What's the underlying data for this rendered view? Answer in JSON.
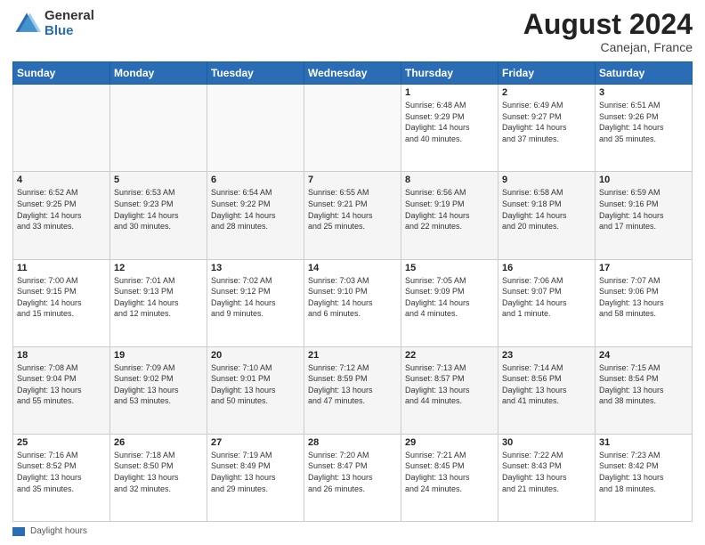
{
  "logo": {
    "general": "General",
    "blue": "Blue"
  },
  "title": {
    "month": "August 2024",
    "location": "Canejan, France"
  },
  "legend": {
    "label": "Daylight hours"
  },
  "headers": [
    "Sunday",
    "Monday",
    "Tuesday",
    "Wednesday",
    "Thursday",
    "Friday",
    "Saturday"
  ],
  "weeks": [
    [
      {
        "day": "",
        "info": ""
      },
      {
        "day": "",
        "info": ""
      },
      {
        "day": "",
        "info": ""
      },
      {
        "day": "",
        "info": ""
      },
      {
        "day": "1",
        "info": "Sunrise: 6:48 AM\nSunset: 9:29 PM\nDaylight: 14 hours\nand 40 minutes."
      },
      {
        "day": "2",
        "info": "Sunrise: 6:49 AM\nSunset: 9:27 PM\nDaylight: 14 hours\nand 37 minutes."
      },
      {
        "day": "3",
        "info": "Sunrise: 6:51 AM\nSunset: 9:26 PM\nDaylight: 14 hours\nand 35 minutes."
      }
    ],
    [
      {
        "day": "4",
        "info": "Sunrise: 6:52 AM\nSunset: 9:25 PM\nDaylight: 14 hours\nand 33 minutes."
      },
      {
        "day": "5",
        "info": "Sunrise: 6:53 AM\nSunset: 9:23 PM\nDaylight: 14 hours\nand 30 minutes."
      },
      {
        "day": "6",
        "info": "Sunrise: 6:54 AM\nSunset: 9:22 PM\nDaylight: 14 hours\nand 28 minutes."
      },
      {
        "day": "7",
        "info": "Sunrise: 6:55 AM\nSunset: 9:21 PM\nDaylight: 14 hours\nand 25 minutes."
      },
      {
        "day": "8",
        "info": "Sunrise: 6:56 AM\nSunset: 9:19 PM\nDaylight: 14 hours\nand 22 minutes."
      },
      {
        "day": "9",
        "info": "Sunrise: 6:58 AM\nSunset: 9:18 PM\nDaylight: 14 hours\nand 20 minutes."
      },
      {
        "day": "10",
        "info": "Sunrise: 6:59 AM\nSunset: 9:16 PM\nDaylight: 14 hours\nand 17 minutes."
      }
    ],
    [
      {
        "day": "11",
        "info": "Sunrise: 7:00 AM\nSunset: 9:15 PM\nDaylight: 14 hours\nand 15 minutes."
      },
      {
        "day": "12",
        "info": "Sunrise: 7:01 AM\nSunset: 9:13 PM\nDaylight: 14 hours\nand 12 minutes."
      },
      {
        "day": "13",
        "info": "Sunrise: 7:02 AM\nSunset: 9:12 PM\nDaylight: 14 hours\nand 9 minutes."
      },
      {
        "day": "14",
        "info": "Sunrise: 7:03 AM\nSunset: 9:10 PM\nDaylight: 14 hours\nand 6 minutes."
      },
      {
        "day": "15",
        "info": "Sunrise: 7:05 AM\nSunset: 9:09 PM\nDaylight: 14 hours\nand 4 minutes."
      },
      {
        "day": "16",
        "info": "Sunrise: 7:06 AM\nSunset: 9:07 PM\nDaylight: 14 hours\nand 1 minute."
      },
      {
        "day": "17",
        "info": "Sunrise: 7:07 AM\nSunset: 9:06 PM\nDaylight: 13 hours\nand 58 minutes."
      }
    ],
    [
      {
        "day": "18",
        "info": "Sunrise: 7:08 AM\nSunset: 9:04 PM\nDaylight: 13 hours\nand 55 minutes."
      },
      {
        "day": "19",
        "info": "Sunrise: 7:09 AM\nSunset: 9:02 PM\nDaylight: 13 hours\nand 53 minutes."
      },
      {
        "day": "20",
        "info": "Sunrise: 7:10 AM\nSunset: 9:01 PM\nDaylight: 13 hours\nand 50 minutes."
      },
      {
        "day": "21",
        "info": "Sunrise: 7:12 AM\nSunset: 8:59 PM\nDaylight: 13 hours\nand 47 minutes."
      },
      {
        "day": "22",
        "info": "Sunrise: 7:13 AM\nSunset: 8:57 PM\nDaylight: 13 hours\nand 44 minutes."
      },
      {
        "day": "23",
        "info": "Sunrise: 7:14 AM\nSunset: 8:56 PM\nDaylight: 13 hours\nand 41 minutes."
      },
      {
        "day": "24",
        "info": "Sunrise: 7:15 AM\nSunset: 8:54 PM\nDaylight: 13 hours\nand 38 minutes."
      }
    ],
    [
      {
        "day": "25",
        "info": "Sunrise: 7:16 AM\nSunset: 8:52 PM\nDaylight: 13 hours\nand 35 minutes."
      },
      {
        "day": "26",
        "info": "Sunrise: 7:18 AM\nSunset: 8:50 PM\nDaylight: 13 hours\nand 32 minutes."
      },
      {
        "day": "27",
        "info": "Sunrise: 7:19 AM\nSunset: 8:49 PM\nDaylight: 13 hours\nand 29 minutes."
      },
      {
        "day": "28",
        "info": "Sunrise: 7:20 AM\nSunset: 8:47 PM\nDaylight: 13 hours\nand 26 minutes."
      },
      {
        "day": "29",
        "info": "Sunrise: 7:21 AM\nSunset: 8:45 PM\nDaylight: 13 hours\nand 24 minutes."
      },
      {
        "day": "30",
        "info": "Sunrise: 7:22 AM\nSunset: 8:43 PM\nDaylight: 13 hours\nand 21 minutes."
      },
      {
        "day": "31",
        "info": "Sunrise: 7:23 AM\nSunset: 8:42 PM\nDaylight: 13 hours\nand 18 minutes."
      }
    ]
  ]
}
